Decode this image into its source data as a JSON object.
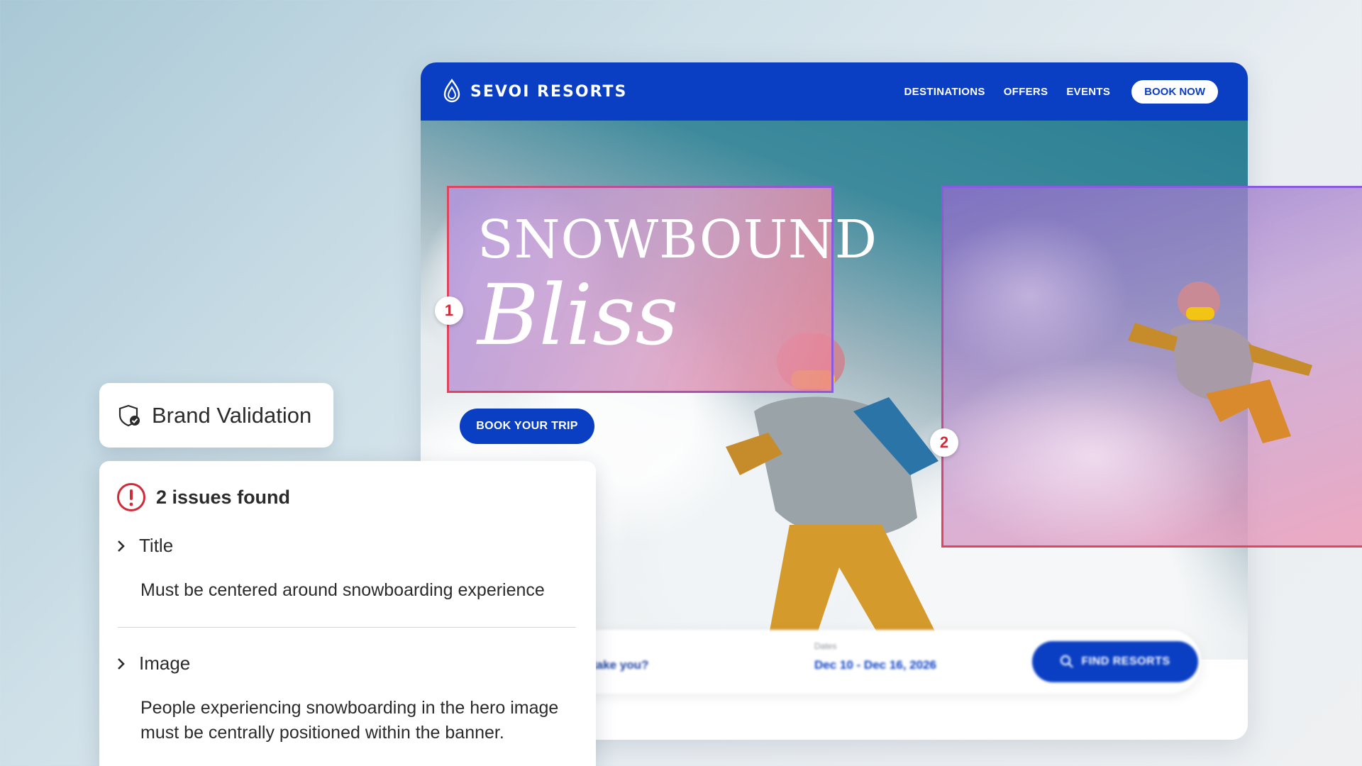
{
  "site": {
    "brand": "SEVOI RESORTS",
    "nav": [
      "DESTINATIONS",
      "OFFERS",
      "EVENTS"
    ],
    "book_now": "BOOK NOW",
    "hero": {
      "title_line1": "SNOWBOUND",
      "title_line2": "Bliss",
      "cta": "BOOK YOUR TRIP"
    },
    "search": {
      "where_value": "take you?",
      "dates_label": "Dates",
      "dates_value": "Dec 10 - Dec 16, 2026",
      "find_button": "FIND RESORTS"
    }
  },
  "markers": {
    "m1": "1",
    "m2": "2"
  },
  "validation": {
    "title": "Brand Validation",
    "issues_summary": "2 issues found",
    "issues": [
      {
        "title": "Title",
        "description": "Must be centered around snowboarding experience"
      },
      {
        "title": "Image",
        "description": "People experiencing snowboarding in the hero image must be centrally positioned within the banner."
      }
    ]
  },
  "colors": {
    "brand_blue": "#0a3fc4",
    "error_red": "#d12b3a",
    "highlight_gradient_start": "#e0455e",
    "highlight_gradient_end": "#8a5ae0"
  }
}
